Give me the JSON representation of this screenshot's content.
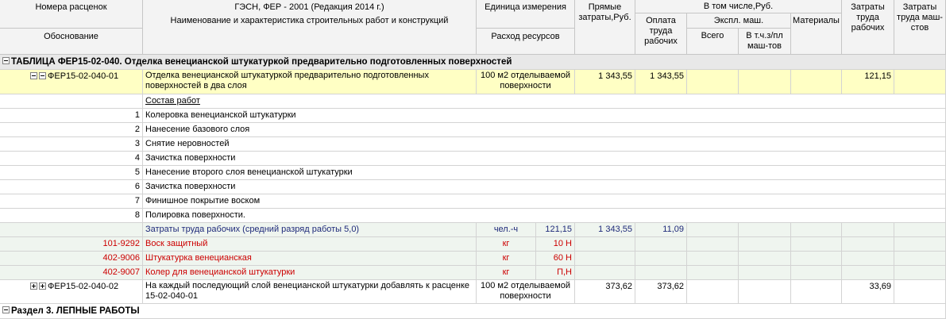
{
  "header": {
    "nomera": "Номера расценок",
    "obosnovanie": "Обоснование",
    "gesn": "ГЭСН, ФЕР - 2001 (Редакция 2014 г.)",
    "naim": "Наименование и характеристика строительных работ и конструкций",
    "ed": "Единица измерения",
    "rashod": "Расход ресурсов",
    "pryamye": "Прямые затраты,Руб.",
    "v_tom": "В том числе,Руб.",
    "oplata": "Оплата труда рабочих",
    "ekspl": "Экспл. маш.",
    "vsego": "Всего",
    "vtch": "В т.ч.з/пл маш-тов",
    "materialy": "Материалы",
    "zatr_rab": "Затраты труда рабочих",
    "zatr_mash": "Затраты труда маш-стов"
  },
  "table_row": "ТАБЛИЦА ФЕР15-02-040. Отделка венецианской штукатуркой предварительно подготовленных поверхностей",
  "item1": {
    "code": "ФЕР15-02-040-01",
    "name": "Отделка венецианской штукатуркой предварительно подготовленных поверхностей в два слоя",
    "unit": "100 м2 отделываемой поверхности",
    "direct": "1 343,55",
    "pay": "1 343,55",
    "labor": "121,15"
  },
  "sostav_label": "Состав работ",
  "steps": [
    {
      "n": "1",
      "text": "Колеровка венецианской штукатурки"
    },
    {
      "n": "2",
      "text": "Нанесение базового слоя"
    },
    {
      "n": "3",
      "text": "Снятие неровностей"
    },
    {
      "n": "4",
      "text": "Зачистка поверхности"
    },
    {
      "n": "5",
      "text": "Нанесение второго слоя венецианской штукатурки"
    },
    {
      "n": "6",
      "text": "Зачистка поверхности"
    },
    {
      "n": "7",
      "text": "Финишное покрытие воском"
    },
    {
      "n": "8",
      "text": "Полировка поверхности."
    }
  ],
  "labor_row": {
    "text": "Затраты труда рабочих (средний разряд работы 5,0)",
    "unit": "чел.-ч",
    "qty": "121,15",
    "direct": "1 343,55",
    "pay": "11,09"
  },
  "materials": [
    {
      "code": "101-9292",
      "name": "Воск защитный",
      "unit": "кг",
      "qty": "10 Н"
    },
    {
      "code": "402-9006",
      "name": "Штукатурка венецианская",
      "unit": "кг",
      "qty": "60 Н"
    },
    {
      "code": "402-9007",
      "name": "Колер для венецианской штукатурки",
      "unit": "кг",
      "qty": "П,Н"
    }
  ],
  "item2": {
    "code": "ФЕР15-02-040-02",
    "name": "На каждый последующий слой венецианской штукатурки добавлять к расценке 15-02-040-01",
    "unit": "100 м2 отделываемой поверхности",
    "direct": "373,62",
    "pay": "373,62",
    "labor": "33,69"
  },
  "section3": "Раздел 3. ЛЕПНЫЕ РАБОТЫ",
  "colors": {
    "selected": "#ffffc4",
    "resources": "#eff5ef",
    "material_text": "#cc0000",
    "labor_text": "#1f2a7a"
  }
}
